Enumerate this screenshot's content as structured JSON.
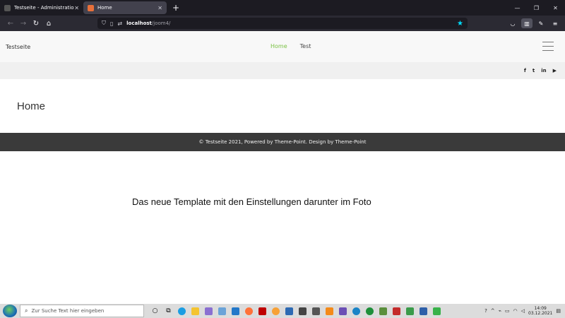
{
  "browser": {
    "tabs": [
      {
        "title": "Testseite - Administration",
        "close": "✕",
        "active": false,
        "favicon_color": "#555555"
      },
      {
        "title": "Home",
        "close": "✕",
        "active": true,
        "favicon_color": "#e8703a"
      }
    ],
    "new_tab": "+",
    "window_controls": {
      "minimize": "—",
      "restore": "❐",
      "close": "✕"
    },
    "url": {
      "host": "localhost",
      "path": "/joom4/"
    },
    "bookmark_color": "#00ddff"
  },
  "site": {
    "brand": "Testseite",
    "menu": [
      {
        "label": "Home",
        "active": true
      },
      {
        "label": "Test",
        "active": false
      }
    ],
    "social": [
      "f",
      "t",
      "in",
      "▶"
    ],
    "page_title": "Home",
    "footer": "© Testseite 2021, Powered by Theme-Point. Design by Theme-Point",
    "accent_color": "#7ac143"
  },
  "note": "Das neue Template mit den Einstellungen darunter im Foto",
  "taskbar": {
    "search_placeholder": "Zur Suche Text hier eingeben",
    "time": "14:09",
    "date": "03.12.2021"
  }
}
